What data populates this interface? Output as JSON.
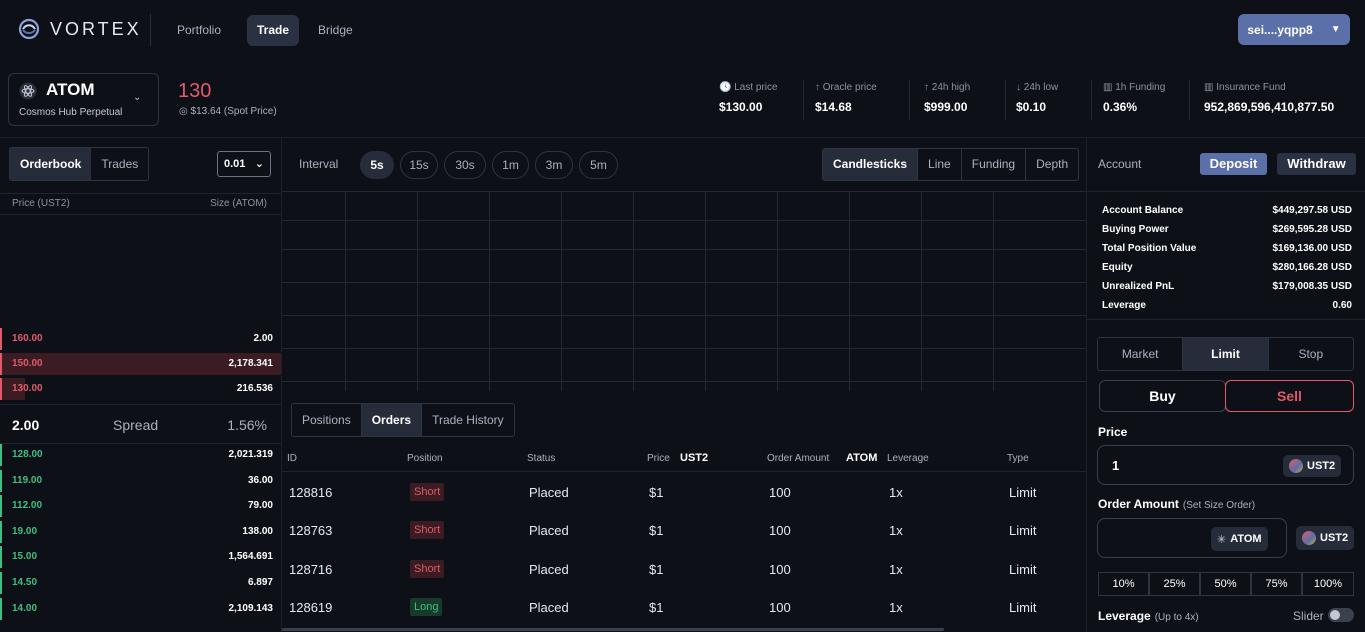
{
  "nav": {
    "brand": "VORTEX",
    "links": [
      "Portfolio",
      "Trade",
      "Bridge"
    ],
    "wallet": "sei....yqpp8"
  },
  "market": {
    "symbol": "ATOM",
    "name": "Cosmos Hub Perpetual",
    "price": "130",
    "spot": "$13.64 (Spot Price)"
  },
  "stats": [
    {
      "label": "Last price",
      "value": "$130.00",
      "icon": "clock-icon"
    },
    {
      "label": "Oracle price",
      "value": "$14.68",
      "icon": "arrow-up-icon"
    },
    {
      "label": "24h high",
      "value": "$999.00",
      "icon": "arrow-up-icon"
    },
    {
      "label": "24h low",
      "value": "$0.10",
      "icon": "arrow-down-icon"
    },
    {
      "label": "1h Funding",
      "value": "0.36%",
      "icon": "bar-chart-icon"
    },
    {
      "label": "Insurance Fund",
      "value": "952,869,596,410,877.50",
      "icon": "bar-chart-icon"
    }
  ],
  "orderbook": {
    "tabs": [
      "Orderbook",
      "Trades"
    ],
    "step": "0.01",
    "price_header": "Price (UST2)",
    "size_header": "Size (ATOM)",
    "asks": [
      {
        "price": "160.00",
        "size": "2.00",
        "depth": 0.0
      },
      {
        "price": "150.00",
        "size": "2,178.341",
        "depth": 1.0
      },
      {
        "price": "130.00",
        "size": "216.536",
        "depth": 0.09
      }
    ],
    "spread_value": "2.00",
    "spread_label": "Spread",
    "spread_pct": "1.56%",
    "bids": [
      {
        "price": "128.00",
        "size": "2,021.319"
      },
      {
        "price": "119.00",
        "size": "36.00"
      },
      {
        "price": "112.00",
        "size": "79.00"
      },
      {
        "price": "19.00",
        "size": "138.00"
      },
      {
        "price": "15.00",
        "size": "1,564.691"
      },
      {
        "price": "14.50",
        "size": "6.897"
      },
      {
        "price": "14.00",
        "size": "2,109.143"
      }
    ]
  },
  "chart": {
    "interval_label": "Interval",
    "intervals": [
      "5s",
      "15s",
      "30s",
      "1m",
      "3m",
      "5m"
    ],
    "types": [
      "Candlesticks",
      "Line",
      "Funding",
      "Depth"
    ]
  },
  "orders": {
    "tabs": [
      "Positions",
      "Orders",
      "Trade History"
    ],
    "headers": {
      "id": "ID",
      "position": "Position",
      "status": "Status",
      "price": "Price",
      "price_unit": "UST2",
      "amount": "Order Amount",
      "amount_unit": "ATOM",
      "leverage": "Leverage",
      "type": "Type"
    },
    "rows": [
      {
        "id": "128816",
        "position": "Short",
        "status": "Placed",
        "price": "$1",
        "amount": "100",
        "leverage": "1x",
        "type": "Limit"
      },
      {
        "id": "128763",
        "position": "Short",
        "status": "Placed",
        "price": "$1",
        "amount": "100",
        "leverage": "1x",
        "type": "Limit"
      },
      {
        "id": "128716",
        "position": "Short",
        "status": "Placed",
        "price": "$1",
        "amount": "100",
        "leverage": "1x",
        "type": "Limit"
      },
      {
        "id": "128619",
        "position": "Long",
        "status": "Placed",
        "price": "$1",
        "amount": "100",
        "leverage": "1x",
        "type": "Limit"
      }
    ]
  },
  "account": {
    "label": "Account",
    "deposit": "Deposit",
    "withdraw": "Withdraw",
    "rows": [
      {
        "k": "Account Balance",
        "v": "$449,297.58 USD"
      },
      {
        "k": "Buying Power",
        "v": "$269,595.28 USD"
      },
      {
        "k": "Total Position Value",
        "v": "$169,136.00 USD"
      },
      {
        "k": "Equity",
        "v": "$280,166.28 USD"
      },
      {
        "k": "Unrealized PnL",
        "v": "$179,008.35 USD"
      },
      {
        "k": "Leverage",
        "v": "0.60"
      }
    ]
  },
  "order_form": {
    "types": [
      "Market",
      "Limit",
      "Stop"
    ],
    "buy": "Buy",
    "sell": "Sell",
    "price_label": "Price",
    "price_value": "1",
    "quote_token": "UST2",
    "amount_label": "Order Amount",
    "amount_hint": "(Set Size Order)",
    "base_token": "ATOM",
    "percents": [
      "10%",
      "25%",
      "50%",
      "75%",
      "100%"
    ],
    "leverage_label": "Leverage",
    "leverage_hint": "(Up to 4x)",
    "slider_label": "Slider"
  },
  "colors": {
    "accent": "#5b6fa8",
    "sell": "#e05a6a",
    "buy": "#3fbf7f",
    "bg": "#0d1117"
  }
}
